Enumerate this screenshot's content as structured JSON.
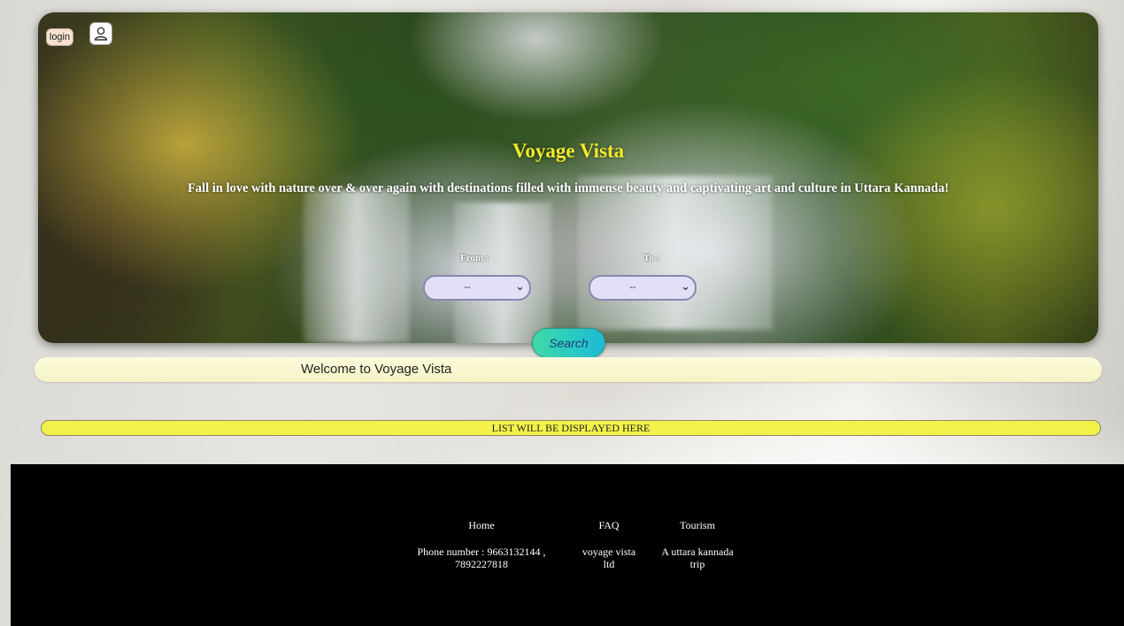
{
  "header": {
    "login_label": "login",
    "user_icon": "user-icon"
  },
  "hero": {
    "title": "Voyage Vista",
    "tagline": "Fall in love with nature over & over again with destinations filled with immense beauty and captivating art and culture in Uttara Kannada!",
    "from_label": "From :",
    "to_label": "To :",
    "from_value": "--",
    "to_value": "--"
  },
  "search": {
    "label": "Search"
  },
  "welcome": {
    "text": "Welcome to Voyage Vista"
  },
  "list": {
    "placeholder": "LIST WILL BE DISPLAYED HERE"
  },
  "footer": {
    "columns": [
      {
        "title": "Home",
        "body_lines": [
          "Phone number : 9663132144 ,",
          "7892227818"
        ]
      },
      {
        "title": "FAQ",
        "body_lines": [
          "voyage vista",
          "ltd"
        ]
      },
      {
        "title": "Tourism",
        "body_lines": [
          "A uttara kannada",
          "trip"
        ]
      }
    ]
  },
  "colors": {
    "title_yellow": "#f3ea2a",
    "search_gradient_start": "#40d9a8",
    "search_gradient_end": "#1fb9d5",
    "list_bar": "#f2f24a",
    "welcome_bar": "#f8f6cf",
    "footer_bg": "#000000"
  }
}
